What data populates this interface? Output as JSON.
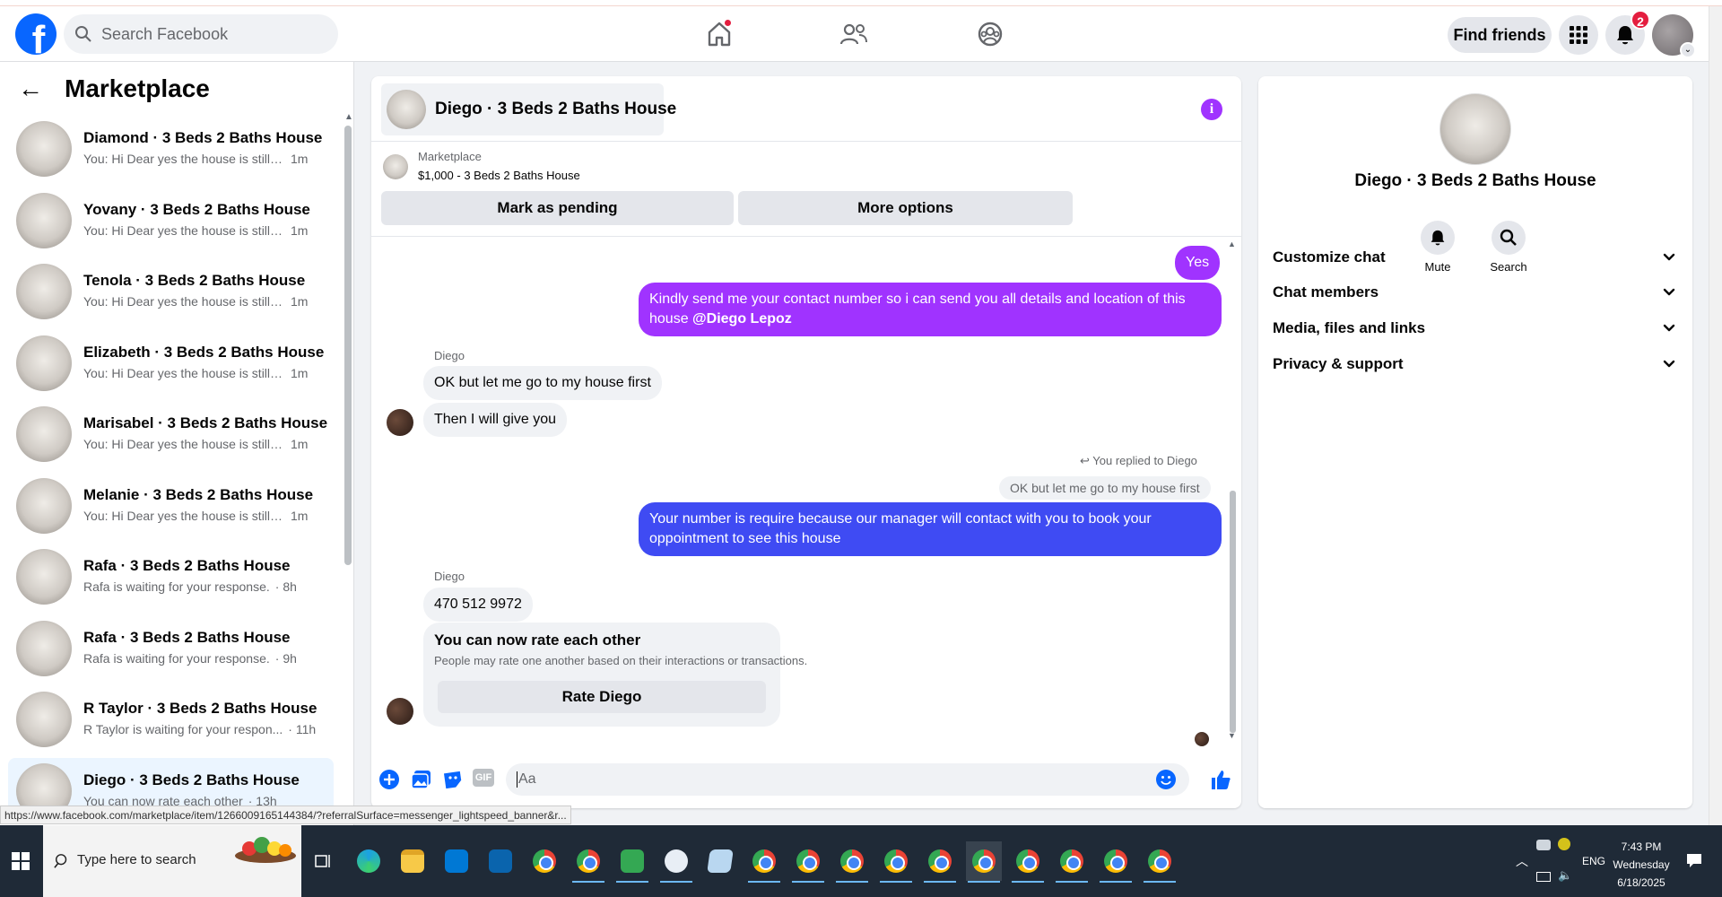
{
  "topbar": {
    "logo_letter": "f",
    "search_placeholder": "Search Facebook",
    "find_friends": "Find friends",
    "notification_count": "2",
    "colors": {
      "brand": "#0866ff",
      "badge": "#e41e3f"
    }
  },
  "sidebar": {
    "title": "Marketplace",
    "conversations": [
      {
        "name": "Diamond · 3 Beds 2 Baths House",
        "preview": "You: Hi Dear yes the house is still a...",
        "time": "1m",
        "active": false
      },
      {
        "name": "Yovany · 3 Beds 2 Baths House",
        "preview": "You: Hi Dear yes the house is still a...",
        "time": "1m",
        "active": false
      },
      {
        "name": "Tenola · 3 Beds 2 Baths House",
        "preview": "You: Hi Dear yes the house is still a...",
        "time": "1m",
        "active": false
      },
      {
        "name": "Elizabeth · 3 Beds 2 Baths House",
        "preview": "You: Hi Dear yes the house is still a...",
        "time": "1m",
        "active": false
      },
      {
        "name": "Marisabel · 3 Beds 2 Baths House",
        "preview": "You: Hi Dear yes the house is still a...",
        "time": "1m",
        "active": false
      },
      {
        "name": "Melanie · 3 Beds 2 Baths House",
        "preview": "You: Hi Dear yes the house is still a...",
        "time": "1m",
        "active": false
      },
      {
        "name": "Rafa · 3 Beds 2 Baths House",
        "preview": "Rafa is waiting for your response.",
        "time": "· 8h",
        "active": false
      },
      {
        "name": "Rafa · 3 Beds 2 Baths House",
        "preview": "Rafa is waiting for your response.",
        "time": "· 9h",
        "active": false
      },
      {
        "name": "R Taylor · 3 Beds 2 Baths House",
        "preview": "R Taylor is waiting for your respon...",
        "time": "· 11h",
        "active": false
      },
      {
        "name": "Diego · 3 Beds 2 Baths House",
        "preview": "You can now rate each other",
        "time": "· 13h",
        "active": true
      }
    ],
    "status_url": "https://www.facebook.com/marketplace/item/1266009165144384/?referralSurface=messenger_lightspeed_banner&r..."
  },
  "chat": {
    "title": "Diego · 3 Beds 2 Baths House",
    "marketplace_label": "Marketplace",
    "listing": "$1,000 - 3 Beds 2 Baths House",
    "mark_pending": "Mark as pending",
    "more_options": "More options",
    "messages": {
      "yes": "Yes",
      "contact_request": "Kindly send me your contact number so i can send you all details and location of this house",
      "mention": "@Diego Lepoz",
      "sender1": "Diego",
      "reply1": "OK but let me go to my house first",
      "reply2": "Then I will give you",
      "replied_note": "You replied to Diego",
      "quoted": "OK but let me go to my house first",
      "number_request": "Your number is require because our manager will contact with you to book your oppointment to see this house",
      "sender2": "Diego",
      "phone": "470 512 9972"
    },
    "rate": {
      "title": "You can now rate each other",
      "subtitle": "People may rate one another based on their interactions or transactions.",
      "button": "Rate Diego"
    },
    "composer_placeholder": "Aa",
    "composer_gif": "GIF",
    "colors": {
      "purple": "#a033ff",
      "blue": "#3f4bf3"
    }
  },
  "info": {
    "name": "Diego · 3 Beds 2 Baths House",
    "mute": "Mute",
    "search": "Search",
    "rows": [
      "Customize chat",
      "Chat members",
      "Media, files and links",
      "Privacy & support"
    ]
  },
  "taskbar": {
    "search_label": "Type here to search",
    "language": "ENG",
    "time": "7:43 PM",
    "day": "Wednesday",
    "date": "6/18/2025"
  }
}
